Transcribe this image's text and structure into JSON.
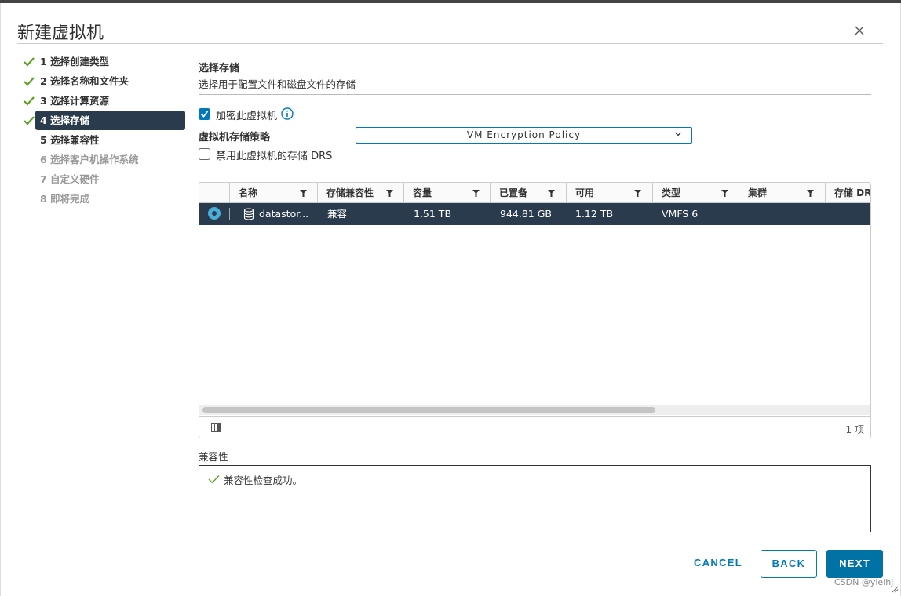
{
  "dialog": {
    "title": "新建虚拟机",
    "close_icon": "close-icon"
  },
  "steps": [
    {
      "label": "1 选择创建类型",
      "state": "completed"
    },
    {
      "label": "2 选择名称和文件夹",
      "state": "completed"
    },
    {
      "label": "3 选择计算资源",
      "state": "completed"
    },
    {
      "label": "4 选择存储",
      "state": "active"
    },
    {
      "label": "5 选择兼容性",
      "state": "pending"
    },
    {
      "label": "6 选择客户机操作系统",
      "state": "disabled"
    },
    {
      "label": "7 自定义硬件",
      "state": "disabled"
    },
    {
      "label": "8 即将完成",
      "state": "disabled"
    }
  ],
  "section": {
    "title": "选择存储",
    "description": "选择用于配置文件和磁盘文件的存储"
  },
  "encrypt": {
    "label": "加密此虚拟机",
    "checked": true
  },
  "policy": {
    "label": "虚拟机存储策略",
    "value": "VM Encryption Policy"
  },
  "disable_drs": {
    "label": "禁用此虚拟机的存储 DRS",
    "checked": false
  },
  "grid": {
    "columns": [
      "名称",
      "存储兼容性",
      "容量",
      "已置备",
      "可用",
      "类型",
      "集群",
      "存储 DRS"
    ],
    "rows": [
      {
        "name": "datastor...",
        "compat": "兼容",
        "capacity": "1.51 TB",
        "provisioned": "944.81 GB",
        "free": "1.12 TB",
        "type": "VMFS 6",
        "cluster": "",
        "drs": "",
        "selected": true
      }
    ],
    "count": "1 项",
    "scroll_fraction": 0.68
  },
  "compatibility": {
    "label": "兼容性",
    "message": "兼容性检查成功。"
  },
  "buttons": {
    "cancel": "CANCEL",
    "back": "BACK",
    "next": "NEXT"
  },
  "watermark": "CSDN @yleihj",
  "colors": {
    "accent": "#0079b8",
    "selected_row": "#2a3b4d",
    "success": "#5aa220"
  }
}
